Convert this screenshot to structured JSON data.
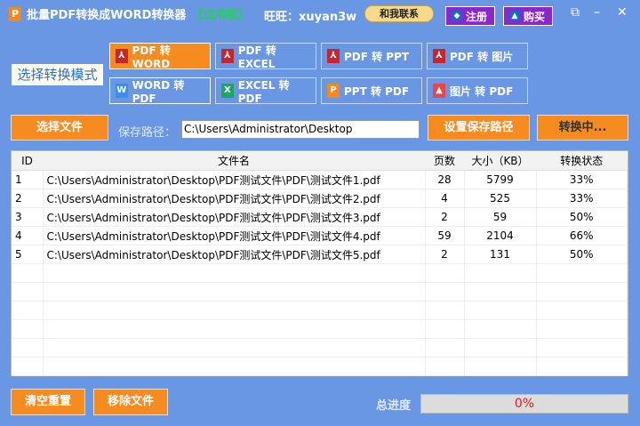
{
  "title": {
    "app": "批量PDF转换成WORD转换器",
    "trial": "【试用版】",
    "wangwang": "旺旺：xuyan3w",
    "contact": "和我联系",
    "register": "注册",
    "buy": "购买"
  },
  "mode_label": "选择转换模式",
  "modes": [
    {
      "label": "PDF 转 WORD",
      "icon": "pdf-icon",
      "color": "#c8252c",
      "selected": true
    },
    {
      "label": "PDF 转 EXCEL",
      "icon": "pdf-icon",
      "color": "#c8252c"
    },
    {
      "label": "PDF 转 PPT",
      "icon": "pdf-icon",
      "color": "#c8252c"
    },
    {
      "label": "PDF 转 图片",
      "icon": "pdf-icon",
      "color": "#c8252c"
    },
    {
      "label": "WORD 转 PDF",
      "icon": "word-icon",
      "color": "#3a8ee6"
    },
    {
      "label": "EXCEL 转 PDF",
      "icon": "excel-icon",
      "color": "#21a366"
    },
    {
      "label": "PPT 转 PDF",
      "icon": "ppt-icon",
      "color": "#f08a1c"
    },
    {
      "label": "图片 转 PDF",
      "icon": "image-icon",
      "color": "#e8474a"
    }
  ],
  "select_file": "选择文件",
  "save_path_label": "保存路径：",
  "save_path": "C:\\Users\\Administrator\\Desktop",
  "set_path": "设置保存路径",
  "converting": "转换中...",
  "table": {
    "headers": [
      "ID",
      "文件名",
      "页数",
      "大小（KB）",
      "转换状态"
    ],
    "rows": [
      [
        "1",
        "C:\\Users\\Administrator\\Desktop\\PDF测试文件\\PDF\\测试文件1.pdf",
        "28",
        "5799",
        "33%"
      ],
      [
        "2",
        "C:\\Users\\Administrator\\Desktop\\PDF测试文件\\PDF\\测试文件2.pdf",
        "4",
        "525",
        "33%"
      ],
      [
        "3",
        "C:\\Users\\Administrator\\Desktop\\PDF测试文件\\PDF\\测试文件3.pdf",
        "2",
        "59",
        "50%"
      ],
      [
        "4",
        "C:\\Users\\Administrator\\Desktop\\PDF测试文件\\PDF\\测试文件4.pdf",
        "59",
        "2104",
        "66%"
      ],
      [
        "5",
        "C:\\Users\\Administrator\\Desktop\\PDF测试文件\\PDF\\测试文件5.pdf",
        "2",
        "131",
        "50%"
      ]
    ]
  },
  "clear": "清空重置",
  "remove": "移除文件",
  "total_label": "总进度",
  "total_progress": "0%"
}
